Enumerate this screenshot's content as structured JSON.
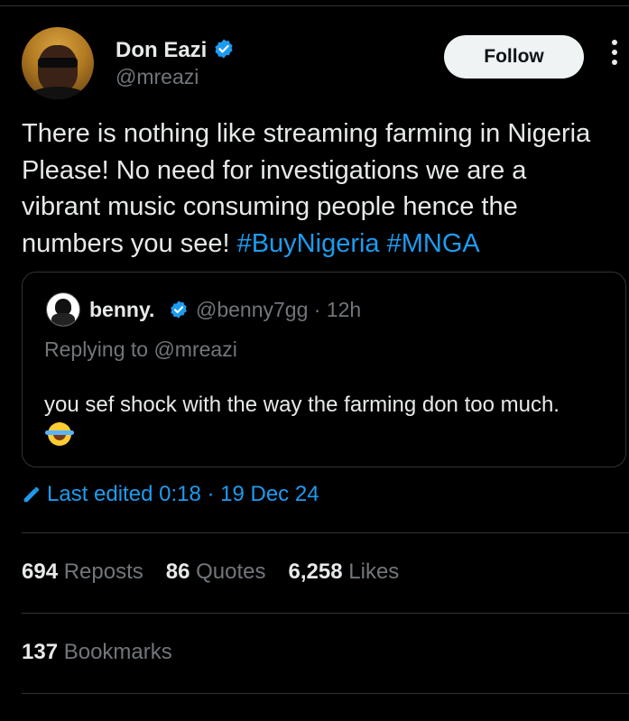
{
  "author": {
    "name": "Don Eazi",
    "handle": "@mreazi",
    "verified": true
  },
  "follow_button": {
    "label": "Follow"
  },
  "more_button": {
    "icon": "more-vertical-icon"
  },
  "tweet": {
    "text": "There is nothing like streaming farming in Nigeria Please! No need for investigations we are a vibrant music consuming people hence the numbers you see!",
    "hashtags": [
      "#BuyNigeria",
      "#MNGA"
    ]
  },
  "quoted_tweet": {
    "name": "benny.",
    "handle": "@benny7gg",
    "separator": "·",
    "time": "12h",
    "replying_to": "Replying to @mreazi",
    "text": "you sef shock with the way the farming don too much.",
    "emoji": "face-with-tears-of-joy"
  },
  "edited": {
    "label": "Last edited 0:18 · 19 Dec 24",
    "icon": "pencil-icon"
  },
  "stats": {
    "reposts_count": "694",
    "reposts_label": "Reposts",
    "quotes_count": "86",
    "quotes_label": "Quotes",
    "likes_count": "6,258",
    "likes_label": "Likes",
    "bookmarks_count": "137",
    "bookmarks_label": "Bookmarks"
  },
  "colors": {
    "background": "#000000",
    "text": "#e7e9ea",
    "muted": "#71767b",
    "accent": "#1d9bf0",
    "border": "#2f3336",
    "button_bg": "#eff3f4"
  }
}
